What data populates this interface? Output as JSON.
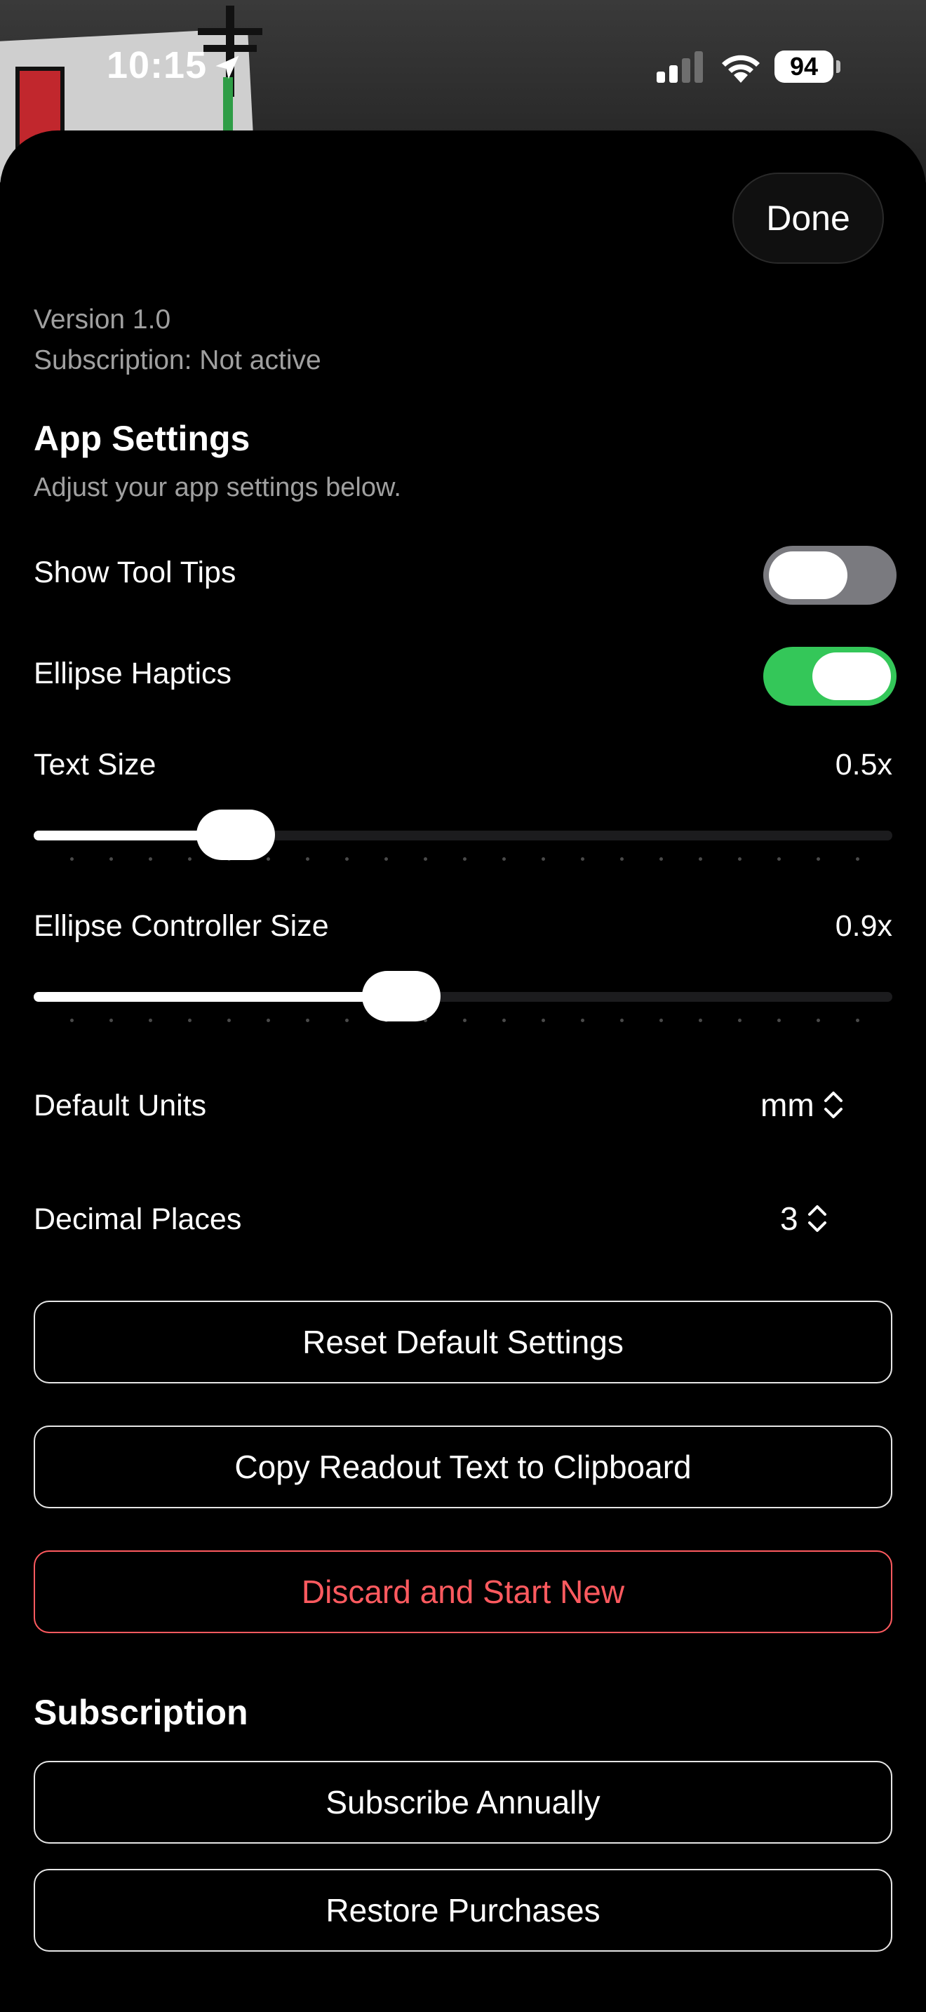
{
  "status_bar": {
    "time": "10:15",
    "battery": "94"
  },
  "sheet": {
    "done_label": "Done",
    "version": "Version 1.0",
    "subscription_status": "Subscription: Not active",
    "app_settings": {
      "title": "App Settings",
      "subtitle": "Adjust your app settings below.",
      "show_tool_tips": {
        "label": "Show Tool Tips",
        "on": false
      },
      "ellipse_haptics": {
        "label": "Ellipse Haptics",
        "on": true
      },
      "text_size": {
        "label": "Text Size",
        "value": "0.5x",
        "fraction": 0.235
      },
      "ellipse_controller_size": {
        "label": "Ellipse Controller Size",
        "value": "0.9x",
        "fraction": 0.428
      },
      "default_units": {
        "label": "Default Units",
        "value": "mm"
      },
      "decimal_places": {
        "label": "Decimal Places",
        "value": "3"
      }
    },
    "buttons": {
      "reset": "Reset Default Settings",
      "copy": "Copy Readout Text to Clipboard",
      "discard": "Discard and Start New"
    },
    "subscription": {
      "title": "Subscription",
      "subscribe": "Subscribe Annually",
      "restore": "Restore Purchases"
    }
  },
  "colors": {
    "toggle_on": "#34c759",
    "destructive": "#ff5a5f"
  }
}
